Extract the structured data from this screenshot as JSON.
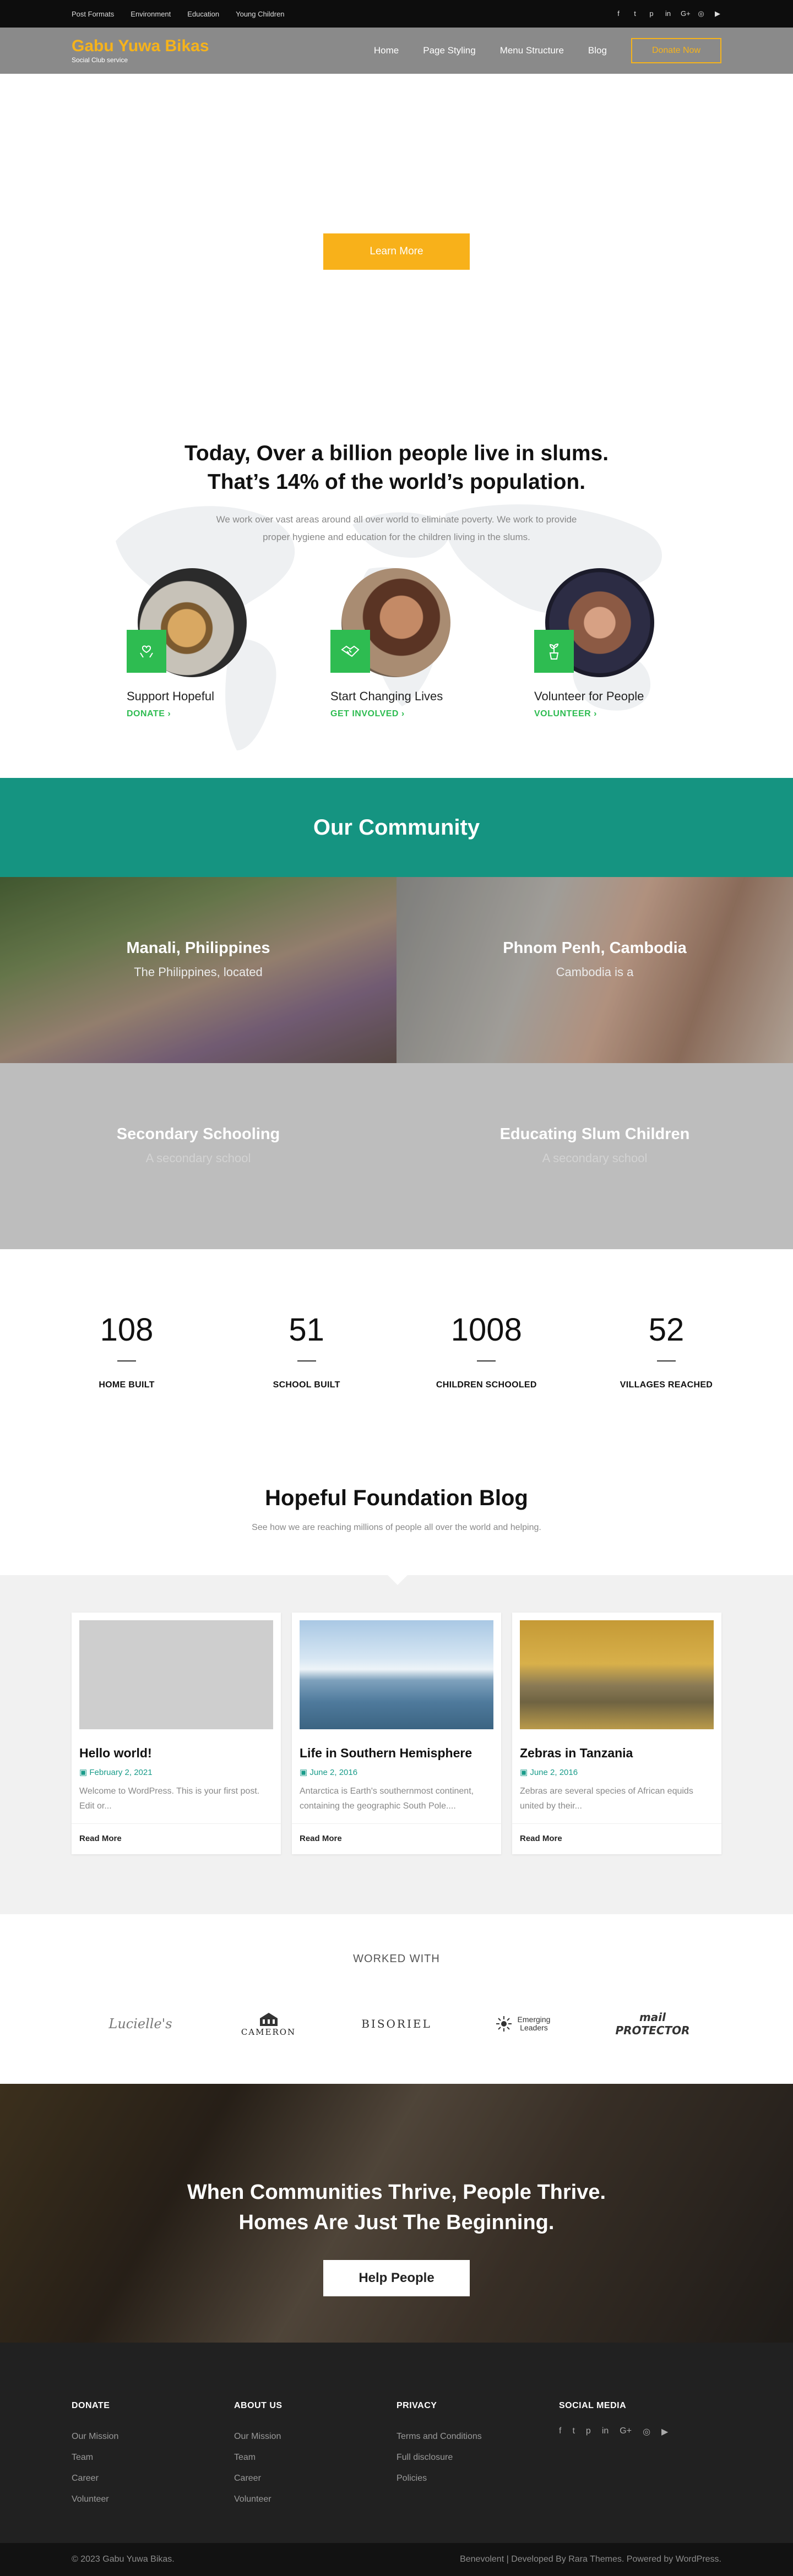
{
  "topbar": {
    "links": [
      "Post Formats",
      "Environment",
      "Education",
      "Young Children"
    ],
    "social_icons": [
      "facebook-icon",
      "twitter-icon",
      "pinterest-icon",
      "linkedin-icon",
      "google-plus-icon",
      "instagram-icon",
      "youtube-icon"
    ],
    "social_glyphs": [
      "f",
      "t",
      "p",
      "in",
      "G+",
      "◎",
      "▶"
    ]
  },
  "header": {
    "site_name": "Gabu Yuwa Bikas",
    "tagline": "Social Club service",
    "nav": [
      "Home",
      "Page Styling",
      "Menu Structure",
      "Blog"
    ],
    "donate_label": "Donate Now"
  },
  "hero": {
    "button_label": "Learn More"
  },
  "mission": {
    "title_line1": "Today, Over a billion people live in slums.",
    "title_line2": "That’s 14% of the world’s population.",
    "sub_line1": "We work over vast areas around all over world to eliminate poverty. We work to provide",
    "sub_line2": "proper hygiene and education for the children living in the slums.",
    "features": [
      {
        "title": "Support Hopeful",
        "link": "DONATE ›"
      },
      {
        "title": "Start Changing Lives",
        "link": "GET INVOLVED ›"
      },
      {
        "title": "Volunteer for People",
        "link": "VOLUNTEER ›"
      }
    ]
  },
  "community": {
    "heading": "Our Community",
    "tiles": [
      {
        "title": "Manali, Philippines",
        "desc": "The Philippines, located"
      },
      {
        "title": "Phnom Penh, Cambodia",
        "desc": "Cambodia is a"
      },
      {
        "title": "Secondary Schooling",
        "desc": "A secondary school"
      },
      {
        "title": "Educating Slum Children",
        "desc": "A secondary school"
      }
    ]
  },
  "stats": [
    {
      "number": "108",
      "label": "HOME BUILT"
    },
    {
      "number": "51",
      "label": "SCHOOL BUILT"
    },
    {
      "number": "1008",
      "label": "CHILDREN SCHOOLED"
    },
    {
      "number": "52",
      "label": "VILLAGES REACHED"
    }
  ],
  "blog": {
    "heading": "Hopeful Foundation Blog",
    "sub": "See how we are reaching millions of people all over the world and helping.",
    "posts": [
      {
        "title": "Hello world!",
        "date": "February 2, 2021",
        "excerpt": "Welcome to WordPress. This is your first post. Edit or...",
        "more": "Read More"
      },
      {
        "title": "Life in Southern Hemisphere",
        "date": "June 2, 2016",
        "excerpt": "Antarctica is Earth's southernmost continent, containing the geographic South Pole....",
        "more": "Read More"
      },
      {
        "title": "Zebras in Tanzania",
        "date": "June 2, 2016",
        "excerpt": "Zebras are several species of African equids united by their...",
        "more": "Read More"
      }
    ]
  },
  "partners": {
    "heading": "WORKED WITH",
    "logos": [
      "Lucielle's",
      "CAMERON",
      "BISORIEL",
      "Emerging Leaders",
      "mail PROTECTOR"
    ]
  },
  "cta": {
    "line1": "When Communities Thrive, People Thrive.",
    "line2": "Homes Are Just The Beginning.",
    "button_label": "Help People"
  },
  "footer": {
    "columns": [
      {
        "title": "DONATE",
        "links": [
          "Our Mission",
          "Team",
          "Career",
          "Volunteer"
        ]
      },
      {
        "title": "ABOUT US",
        "links": [
          "Our Mission",
          "Team",
          "Career",
          "Volunteer"
        ]
      },
      {
        "title": "PRIVACY",
        "links": [
          "Terms and Conditions",
          "Full disclosure",
          "Policies"
        ]
      },
      {
        "title": "SOCIAL MEDIA",
        "links": []
      }
    ],
    "copyright": "© 2023 Gabu Yuwa Bikas.",
    "credits": "Benevolent | Developed By Rara Themes. Powered by WordPress."
  },
  "colors": {
    "brand": "#f6b31b",
    "accent_green": "#2ebc51",
    "teal": "#159481",
    "date_teal": "#1a9c8a"
  }
}
